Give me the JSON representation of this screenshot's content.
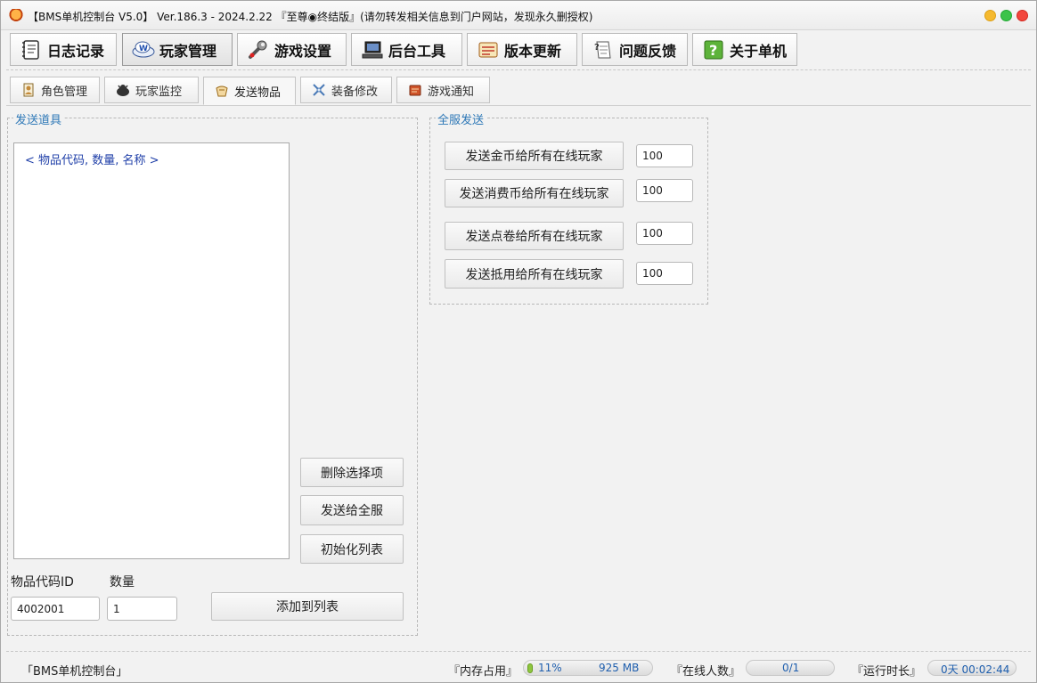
{
  "window": {
    "title": "【BMS单机控制台 V5.0】 Ver.186.3 - 2024.2.22 『至尊◉终结版』(请勿转发相关信息到门户网站，发现永久删授权)"
  },
  "main_tabs": [
    {
      "label": "日志记录",
      "icon": "notebook-icon"
    },
    {
      "label": "玩家管理",
      "icon": "player-icon"
    },
    {
      "label": "游戏设置",
      "icon": "wrench-icon"
    },
    {
      "label": "后台工具",
      "icon": "computer-icon"
    },
    {
      "label": "版本更新",
      "icon": "update-icon"
    },
    {
      "label": "问题反馈",
      "icon": "feedback-icon"
    },
    {
      "label": "关于单机",
      "icon": "help-icon"
    }
  ],
  "active_main_tab": "玩家管理",
  "sub_tabs": [
    {
      "label": "角色管理",
      "icon": "character-icon"
    },
    {
      "label": "玩家监控",
      "icon": "monitor-icon"
    },
    {
      "label": "发送物品",
      "icon": "gift-icon"
    },
    {
      "label": "装备修改",
      "icon": "equipment-icon"
    },
    {
      "label": "游戏通知",
      "icon": "notice-icon"
    }
  ],
  "active_sub_tab": "发送物品",
  "send_items": {
    "group_title": "发送道具",
    "list_items": [
      "< 物品代码, 数量, 名称 >"
    ],
    "delete_button": "删除选择项",
    "send_all_button": "发送给全服",
    "init_list_button": "初始化列表",
    "item_id_label": "物品代码ID",
    "item_id_value": "4002001",
    "quantity_label": "数量",
    "quantity_value": "1",
    "add_button": "添加到列表"
  },
  "server_send": {
    "group_title": "全服发送",
    "rows": [
      {
        "button": "发送金币给所有在线玩家",
        "value": "100"
      },
      {
        "button": "发送消费币给所有在线玩家",
        "value": "100"
      },
      {
        "button": "发送点卷给所有在线玩家",
        "value": "100"
      },
      {
        "button": "发送抵用给所有在线玩家",
        "value": "100"
      }
    ]
  },
  "status_bar": {
    "app_name": "「BMS单机控制台」",
    "memory_label": "『内存占用』",
    "memory_percent": "11%",
    "memory_size": "925 MB",
    "online_label": "『在线人数』",
    "online_value": "0/1",
    "runtime_label": "『运行时长』",
    "runtime_value": "0天 00:02:44"
  },
  "colors": {
    "accent_blue": "#2e78b7",
    "list_text": "#1f3fa8",
    "status_value": "#1f5fae",
    "memory_green": "#8ec63f"
  }
}
